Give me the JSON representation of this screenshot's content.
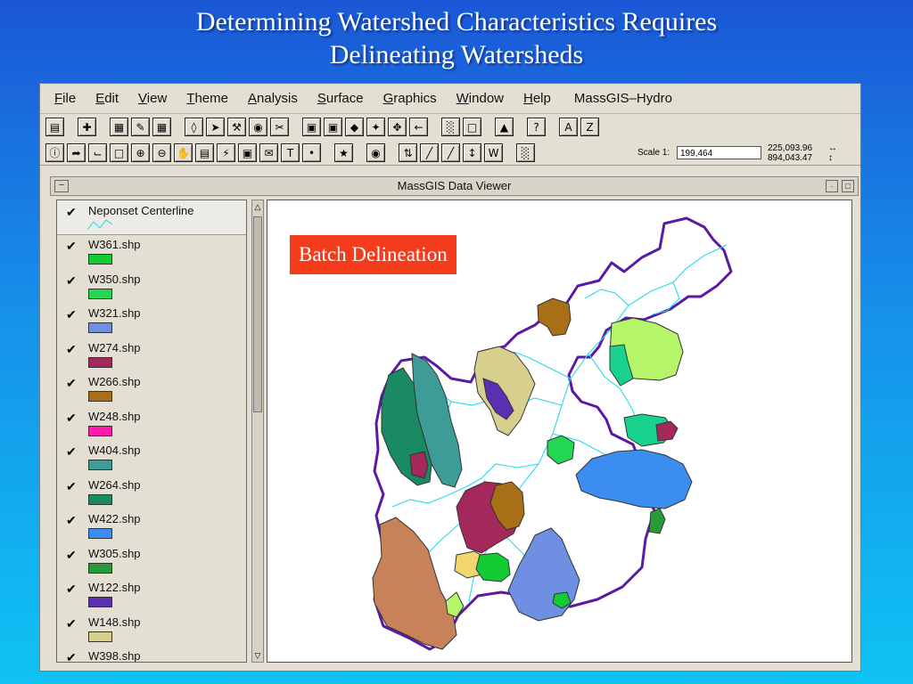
{
  "slide": {
    "title_line1": "Determining Watershed Characteristics Requires",
    "title_line2": "Delineating Watersheds"
  },
  "app": {
    "menus": [
      {
        "first": "F",
        "rest": "ile"
      },
      {
        "first": "E",
        "rest": "dit"
      },
      {
        "first": "V",
        "rest": "iew"
      },
      {
        "first": "T",
        "rest": "heme"
      },
      {
        "first": "A",
        "rest": "nalysis"
      },
      {
        "first": "S",
        "rest": "urface"
      },
      {
        "first": "G",
        "rest": "raphics"
      },
      {
        "first": "W",
        "rest": "indow"
      },
      {
        "first": "H",
        "rest": "elp"
      }
    ],
    "app_name": "MassGIS–Hydro",
    "scale_label": "Scale 1:",
    "scale_value": "199,464",
    "coord_x": "225,093.96",
    "coord_y": "894,043.47"
  },
  "viewer": {
    "title": "MassGIS Data Viewer",
    "batch_label": "Batch Delineation"
  },
  "legend": {
    "first": {
      "name": "Neponset Centerline",
      "line_color": "#4fd6f0"
    },
    "layers": [
      {
        "name": "W361.shp",
        "color": "#13cc33"
      },
      {
        "name": "W350.shp",
        "color": "#23d653"
      },
      {
        "name": "W321.shp",
        "color": "#6f8fe3"
      },
      {
        "name": "W274.shp",
        "color": "#a3295c"
      },
      {
        "name": "W266.shp",
        "color": "#a86f17"
      },
      {
        "name": "W248.shp",
        "color": "#ff1cac"
      },
      {
        "name": "W404.shp",
        "color": "#3d9c96"
      },
      {
        "name": "W264.shp",
        "color": "#1a8a63"
      },
      {
        "name": "W422.shp",
        "color": "#3c8df0"
      },
      {
        "name": "W305.shp",
        "color": "#279a3c"
      },
      {
        "name": "W122.shp",
        "color": "#5a2fb0"
      },
      {
        "name": "W148.shp",
        "color": "#d7cf8e"
      },
      {
        "name": "W398.shp",
        "color": "#999999"
      }
    ]
  },
  "colors": {
    "basin_outline": "#5b1aa3",
    "river": "#2ad8f0"
  }
}
